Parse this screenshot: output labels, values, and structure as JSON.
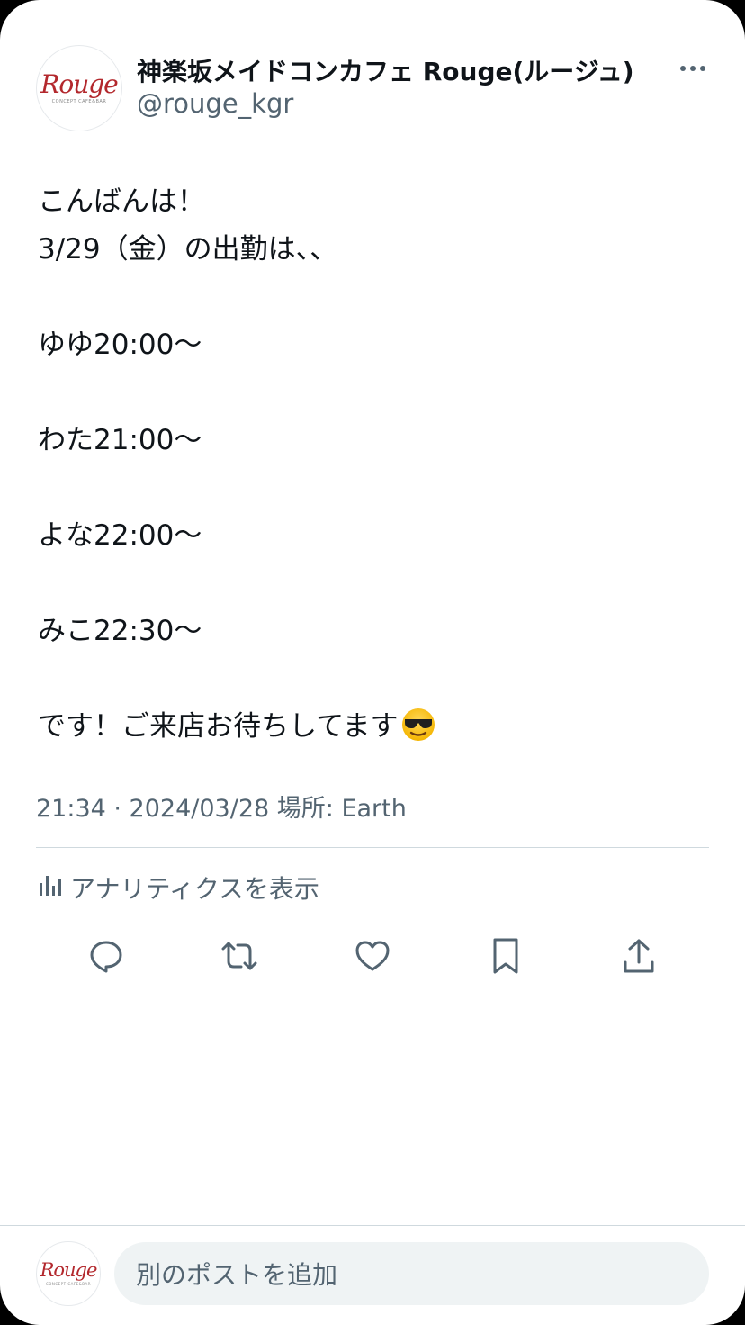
{
  "author": {
    "name": "神楽坂メイドコンカフェ Rouge(ルージュ)",
    "handle": "@rouge_kgr",
    "avatar_text": "Rouge",
    "avatar_subtext": "CONCEPT CAFE&BAR"
  },
  "tweet": {
    "text": "こんばんは！\n3/29（金）の出勤は、、\n\nゆゆ20:00〜\n\nわた21:00〜\n\nよな22:00〜\n\nみこ22:30〜\n\nです！ご来店お待ちしてます",
    "emoji": "smiling-face-with-sunglasses",
    "meta": "21:34 · 2024/03/28 場所: Earth"
  },
  "analytics_label": "アナリティクスを表示",
  "actions": [
    "reply-icon",
    "repost-icon",
    "like-icon",
    "bookmark-icon",
    "share-icon"
  ],
  "reply_box": {
    "placeholder": "別のポストを追加"
  },
  "colors": {
    "text": "#0f1419",
    "secondary": "#536471",
    "divider": "#cfd9de",
    "brand": "#b3282d",
    "input_bg": "#eff3f4"
  }
}
